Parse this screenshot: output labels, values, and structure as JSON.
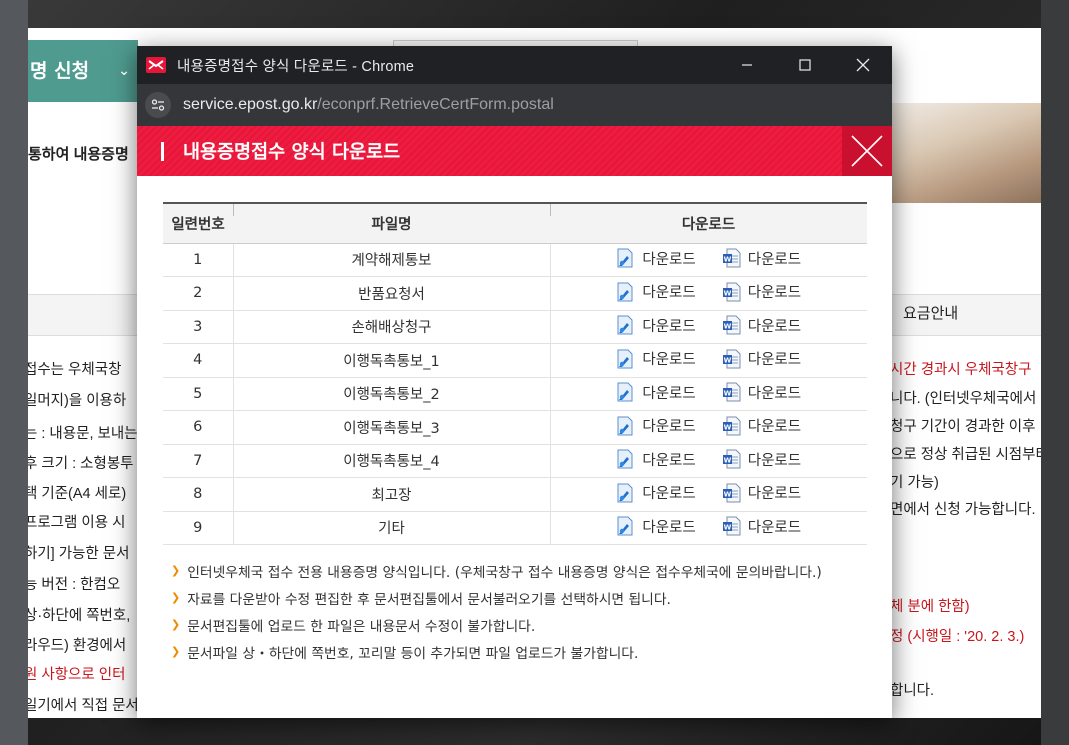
{
  "background_page": {
    "nav_label": "명 신청",
    "intro_text": "통하여 내용증명",
    "tab_label": "요금안내",
    "left_lines": [
      "접수는 우체국창",
      "일머지)을 이용하",
      "는 : 내용문, 보내는",
      "후 크기 : 소형봉투",
      "택 기준(A4 세로)",
      "프로그램 이용 시",
      "하기] 가능한 문서",
      "능 버전 : 한컴오",
      "상·하단에 쪽번호,",
      "라우드) 환경에서",
      "원 사항으로 인터",
      "일기에서 직접 문서"
    ],
    "right_lines": [
      "시간 경과시 우체국창구",
      "니다. (인터넷우체국에서",
      "청구 기간이 경과한 이후",
      "으로 정상 취급된 시점부터",
      "기 가능)",
      "면에서 신청 가능합니다.",
      "체 분에 한함)",
      "정 (시행일 : '20. 2. 3.)",
      "합니다."
    ]
  },
  "window": {
    "title": "내용증명접수 양식 다운로드 - Chrome",
    "url_host": "service.epost.go.kr",
    "url_path": "/econprf.RetrieveCertForm.postal"
  },
  "page": {
    "title": "내용증명접수 양식 다운로드"
  },
  "table": {
    "headers": [
      "일련번호",
      "파일명",
      "다운로드"
    ],
    "rows": [
      {
        "no": "1",
        "name": "계약해제통보",
        "dl1": "다운로드",
        "dl2": "다운로드"
      },
      {
        "no": "2",
        "name": "반품요청서",
        "dl1": "다운로드",
        "dl2": "다운로드"
      },
      {
        "no": "3",
        "name": "손해배상청구",
        "dl1": "다운로드",
        "dl2": "다운로드"
      },
      {
        "no": "4",
        "name": "이행독촉통보_1",
        "dl1": "다운로드",
        "dl2": "다운로드"
      },
      {
        "no": "5",
        "name": "이행독촉통보_2",
        "dl1": "다운로드",
        "dl2": "다운로드"
      },
      {
        "no": "6",
        "name": "이행독촉통보_3",
        "dl1": "다운로드",
        "dl2": "다운로드"
      },
      {
        "no": "7",
        "name": "이행독촉통보_4",
        "dl1": "다운로드",
        "dl2": "다운로드"
      },
      {
        "no": "8",
        "name": "최고장",
        "dl1": "다운로드",
        "dl2": "다운로드"
      },
      {
        "no": "9",
        "name": "기타",
        "dl1": "다운로드",
        "dl2": "다운로드"
      }
    ]
  },
  "notes": [
    "인터넷우체국 접수 전용 내용증명 양식입니다. (우체국창구 접수 내용증명 양식은 접수우체국에 문의바랍니다.)",
    "자료를 다운받아 수정 편집한 후 문서편집툴에서 문서불러오기를 선택하시면 됩니다.",
    "문서편집툴에 업로드 한 파일은 내용문서 수정이 불가합니다.",
    "문서파일 상・하단에 쪽번호, 꼬리말 등이 추가되면 파일 업로드가 불가합니다."
  ],
  "icons": {
    "hwp": "hwp-file-icon",
    "doc": "word-file-icon"
  },
  "colors": {
    "header_red": "#ee1c40",
    "bullet_orange": "#f08a00",
    "nav_teal": "#4f9b8f"
  }
}
